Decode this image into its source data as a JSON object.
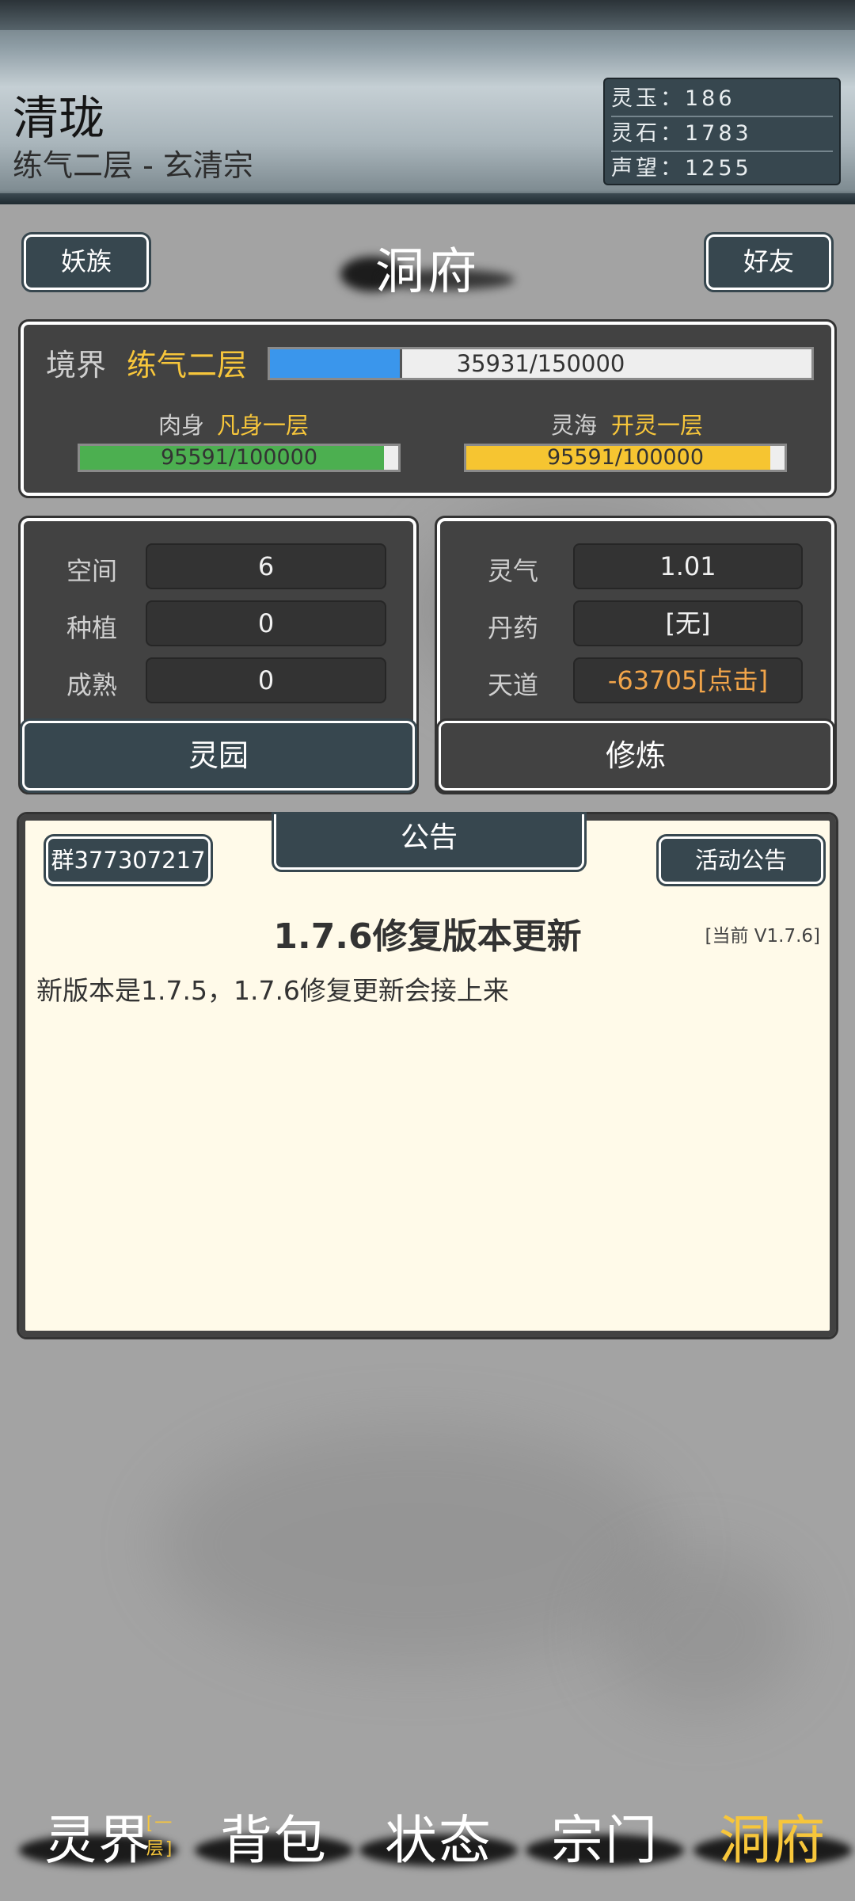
{
  "player": {
    "name": "清珑",
    "subtitle": "练气二层 - 玄清宗"
  },
  "currencies": [
    {
      "label": "灵玉：186"
    },
    {
      "label": "灵石：1783"
    },
    {
      "label": "声望：1255"
    }
  ],
  "topbar": {
    "left_button": "妖族",
    "title": "洞府",
    "right_button": "好友"
  },
  "realm": {
    "label": "境界",
    "value": "练气二层",
    "progress_text": "35931/150000",
    "progress": 0.2395,
    "body": {
      "label": "肉身",
      "value": "凡身一层",
      "progress_text": "95591/100000",
      "progress": 0.956
    },
    "sea": {
      "label": "灵海",
      "value": "开灵一层",
      "progress_text": "95591/100000",
      "progress": 0.956
    }
  },
  "garden": {
    "rows": [
      {
        "label": "空间",
        "value": "6"
      },
      {
        "label": "种植",
        "value": "0"
      },
      {
        "label": "成熟",
        "value": "0"
      }
    ],
    "button": "灵园"
  },
  "cultivate": {
    "rows": [
      {
        "label": "灵气",
        "value": "1.01"
      },
      {
        "label": "丹药",
        "value": "[无]"
      },
      {
        "label": "天道",
        "value": "-63705[点击]"
      }
    ],
    "button": "修炼"
  },
  "notice": {
    "group_button": "群377307217",
    "tab": "公告",
    "activity_button": "活动公告",
    "headline": "1.7.6修复版本更新",
    "version": "[当前 V1.7.6]",
    "body": "新版本是1.7.5，1.7.6修复更新会接上来"
  },
  "nav": [
    {
      "label": "灵界",
      "badge": "[一层]"
    },
    {
      "label": "背包"
    },
    {
      "label": "状态"
    },
    {
      "label": "宗门"
    },
    {
      "label": "洞府"
    }
  ],
  "colors": {
    "panel": "#424242",
    "button_blue": "#37474f",
    "gold": "#f7c63b",
    "orange": "#f2a54a",
    "realm_bar": "#3a96ec",
    "body_bar": "#4caf50",
    "sea_bar": "#f6c531",
    "notice_bg": "#fffae9"
  }
}
